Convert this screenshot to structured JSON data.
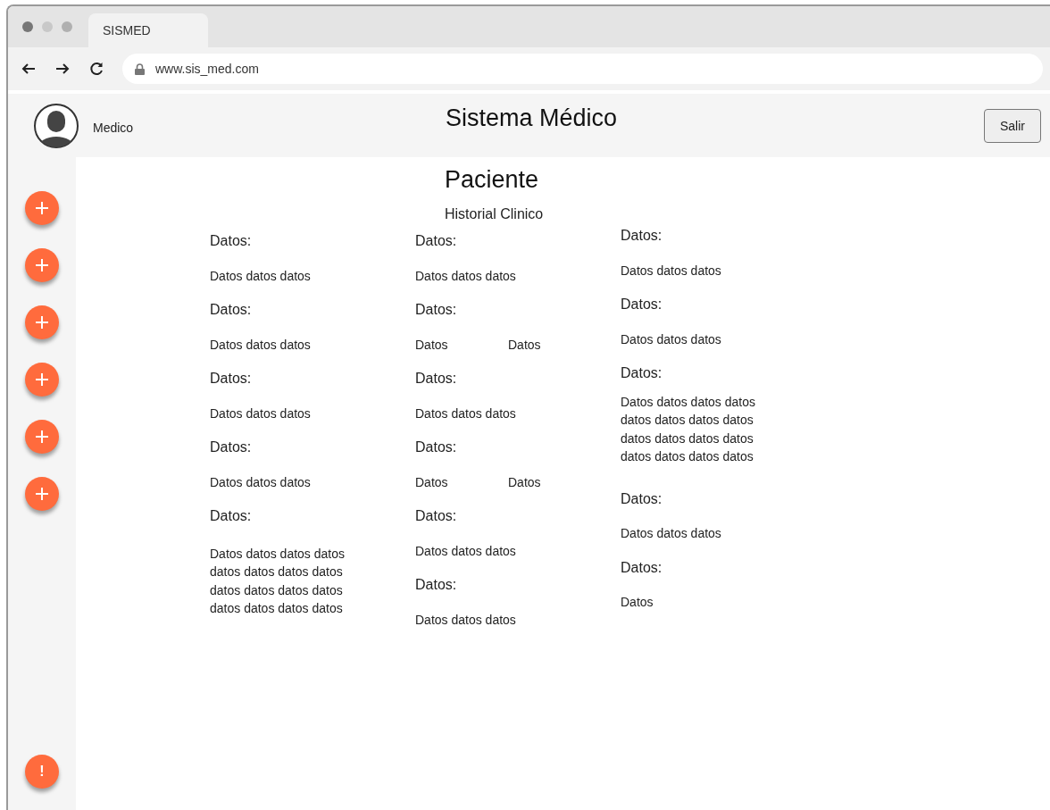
{
  "browser": {
    "tab": {
      "title": "SISMED"
    },
    "address": "www.sis_med.com"
  },
  "header": {
    "user": "Medico",
    "title": "Sistema Médico",
    "logout": "Salir"
  },
  "sidebar": {
    "buttons": [
      {
        "kind": "add"
      },
      {
        "kind": "add"
      },
      {
        "kind": "add"
      },
      {
        "kind": "add"
      },
      {
        "kind": "add"
      },
      {
        "kind": "add"
      }
    ],
    "alert": "!"
  },
  "content": {
    "title": "Paciente",
    "subtitle": "Historial Clinico",
    "columns": [
      {
        "items": [
          {
            "kind": "label",
            "text": "Datos:"
          },
          {
            "kind": "value",
            "text": "Datos datos datos"
          },
          {
            "kind": "label",
            "text": "Datos:"
          },
          {
            "kind": "value",
            "text": "Datos datos datos"
          },
          {
            "kind": "label",
            "text": "Datos:"
          },
          {
            "kind": "value",
            "text": "Datos datos datos"
          },
          {
            "kind": "label",
            "text": "Datos:"
          },
          {
            "kind": "value",
            "text": "Datos datos datos"
          },
          {
            "kind": "label",
            "text": "Datos:"
          },
          {
            "kind": "paragraph",
            "text": "Datos datos datos datos datos datos datos datos datos datos datos datos datos datos datos datos"
          }
        ]
      },
      {
        "items": [
          {
            "kind": "label",
            "text": "Datos:"
          },
          {
            "kind": "value",
            "text": "Datos datos datos"
          },
          {
            "kind": "label",
            "text": "Datos:"
          },
          {
            "kind": "pair",
            "texts": [
              "Datos",
              "Datos"
            ]
          },
          {
            "kind": "label",
            "text": "Datos:"
          },
          {
            "kind": "value",
            "text": "Datos datos datos"
          },
          {
            "kind": "label",
            "text": "Datos:"
          },
          {
            "kind": "pair",
            "texts": [
              "Datos",
              "Datos"
            ]
          },
          {
            "kind": "label",
            "text": "Datos:"
          },
          {
            "kind": "value",
            "text": "Datos datos datos"
          },
          {
            "kind": "label",
            "text": "Datos:"
          },
          {
            "kind": "value",
            "text": "Datos datos datos"
          }
        ]
      },
      {
        "items": [
          {
            "kind": "label",
            "text": "Datos:"
          },
          {
            "kind": "value",
            "text": "Datos datos datos"
          },
          {
            "kind": "label",
            "text": "Datos:"
          },
          {
            "kind": "value",
            "text": "Datos datos datos"
          },
          {
            "kind": "label",
            "text": "Datos:"
          },
          {
            "kind": "paragraph",
            "text": "Datos datos datos datos datos datos datos datos datos datos datos datos datos datos datos datos"
          },
          {
            "kind": "label",
            "text": "Datos:"
          },
          {
            "kind": "value",
            "text": "Datos datos datos"
          },
          {
            "kind": "label",
            "text": "Datos:"
          },
          {
            "kind": "value",
            "text": "Datos"
          }
        ]
      }
    ]
  }
}
